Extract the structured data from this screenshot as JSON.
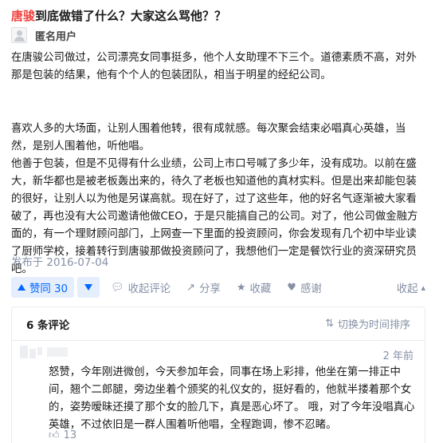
{
  "question": {
    "title_highlight": "唐骏",
    "title_rest": "到底做错了什么？大家这么骂他？？"
  },
  "author": {
    "name": "匿名用户",
    "avatar_icon": "anonymous-avatar-icon"
  },
  "answer": {
    "paragraph1": "在唐骏公司做过，公司漂亮女同事挺多，他个人女助理不下三个。道德素质不高，对外那是包装的结果，他有个个人的包装团队，相当于明星的经纪公司。",
    "paragraph2": "喜欢人多的大场面，让别人围着他转，很有成就感。每次聚会结束必唱真心英雄，当然，是别人围着他，听他唱。",
    "paragraph3": "他善于包装，但是不见得有什么业绩，公司上市口号喊了多少年，没有成功。以前在盛大，新华都也是被老板轰出来的，待久了老板也知道他的真材实料。但是出来却能包装的很好，让别人以为他是另谋高就。现在好了，过了这些年，他的好名气逐渐被大家看破了，再也没有大公司邀请他做CEO，于是只能搞自己的公司。对了，他公司做金融方面的，有一个理财顾问部门，上网查一下里面的投资顾问，你会发现有几个初中毕业读了厨师学校，接着转行到唐骏那做投资顾问了，我想他们一定是餐饮行业的资深研究员吧。",
    "date": "发布于 2016-07-04"
  },
  "actions": {
    "vote_label": "赞同 30",
    "comment_label": "收起评论",
    "share_label": "分享",
    "favorite_label": "收藏",
    "thanks_label": "感谢",
    "collapse_label": "收起"
  },
  "comments": {
    "count_label": "6 条评论",
    "sort_label": "切换为时间排序",
    "items": [
      {
        "time": "2 年前",
        "text": "怒赞，今年刚进微创，今天参加年会，同事在场上彩排，他坐在第一排正中间，翘个二郎腿，旁边坐着个颁奖的礼仪女的，挺好看的，他就半搂着那个女的，姿势暧昧还摸了那个女的脸几下，真是恶心坏了。 哦，对了今年没唱真心英雄，不过依旧是一群人围着听他唱，全程跑调，惨不忍睹。",
        "likes": "13"
      }
    ]
  },
  "colors": {
    "accent": "#0066ff",
    "highlight": "#f1403c",
    "muted": "#8590a6"
  }
}
